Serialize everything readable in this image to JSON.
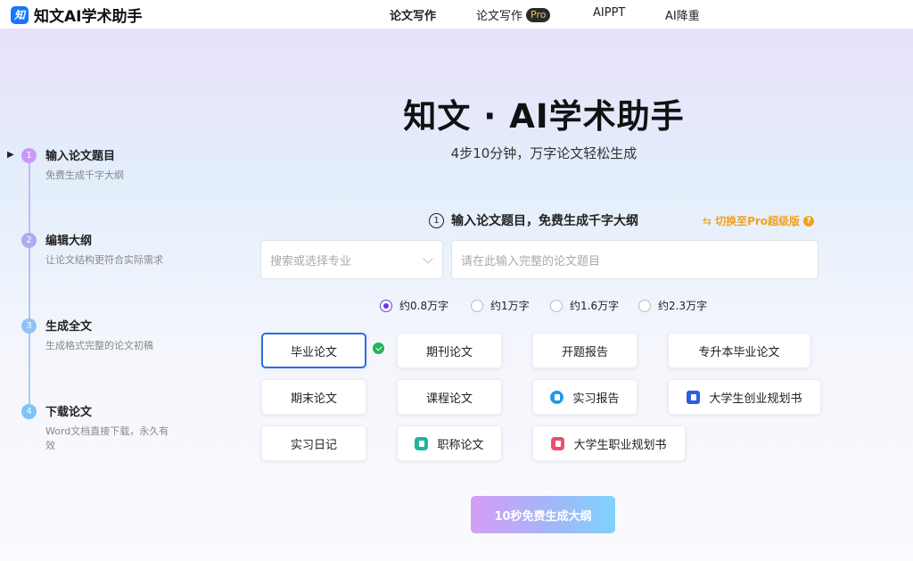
{
  "header": {
    "logo_text": "知",
    "brand": "知文AI学术助手",
    "nav": [
      {
        "label": "论文写作"
      },
      {
        "label": "论文写作",
        "badge": "Pro"
      },
      {
        "label": "AIPPT"
      },
      {
        "label": "AI降重"
      }
    ]
  },
  "hero": {
    "title": "知文 · AI学术助手",
    "subtitle": "4步10分钟，万字论文轻松生成"
  },
  "steps": [
    {
      "num": "1",
      "title": "输入论文题目",
      "desc": "免费生成千字大纲"
    },
    {
      "num": "2",
      "title": "编辑大纲",
      "desc": "让论文结构更符合实际需求"
    },
    {
      "num": "3",
      "title": "生成全文",
      "desc": "生成格式完整的论文初稿"
    },
    {
      "num": "4",
      "title": "下载论文",
      "desc": "Word文档直接下载，永久有效"
    }
  ],
  "form": {
    "step_num": "1",
    "heading": "输入论文题目，免费生成千字大纲",
    "switch_label": "切换至Pro超级版",
    "switch_icon": "⇆",
    "help_icon": "?",
    "major_placeholder": "搜索或选择专业",
    "topic_placeholder": "请在此输入完整的论文题目",
    "word_counts": [
      "约0.8万字",
      "约1万字",
      "约1.6万字",
      "约2.3万字"
    ],
    "selected_word_count": "约0.8万字",
    "paper_types": [
      {
        "label": "毕业论文"
      },
      {
        "label": "期刊论文"
      },
      {
        "label": "开题报告"
      },
      {
        "label": "专升本毕业论文"
      },
      {
        "label": "期末论文"
      },
      {
        "label": "课程论文"
      },
      {
        "label": "实习报告",
        "icon_color": "#1f9be8"
      },
      {
        "label": "大学生创业规划书",
        "icon_color": "#2c5fe0"
      },
      {
        "label": "实习日记"
      },
      {
        "label": "职称论文",
        "icon_color": "#23b39a"
      },
      {
        "label": "大学生职业规划书",
        "icon_color": "#ef4e6b"
      }
    ],
    "selected_type": "毕业论文",
    "submit_label": "10秒免费生成大纲"
  },
  "colors": {
    "accent_purple": "#6a35e8",
    "selected_border": "#2c6fe6",
    "pro_orange": "#f2a01a",
    "check_green": "#21b45a"
  }
}
